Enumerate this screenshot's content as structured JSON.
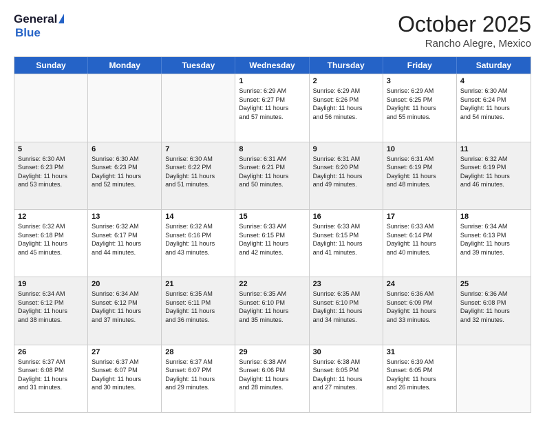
{
  "header": {
    "logo_general": "General",
    "logo_blue": "Blue",
    "month": "October 2025",
    "location": "Rancho Alegre, Mexico"
  },
  "days_of_week": [
    "Sunday",
    "Monday",
    "Tuesday",
    "Wednesday",
    "Thursday",
    "Friday",
    "Saturday"
  ],
  "weeks": [
    [
      {
        "day": "",
        "info": ""
      },
      {
        "day": "",
        "info": ""
      },
      {
        "day": "",
        "info": ""
      },
      {
        "day": "1",
        "info": "Sunrise: 6:29 AM\nSunset: 6:27 PM\nDaylight: 11 hours\nand 57 minutes."
      },
      {
        "day": "2",
        "info": "Sunrise: 6:29 AM\nSunset: 6:26 PM\nDaylight: 11 hours\nand 56 minutes."
      },
      {
        "day": "3",
        "info": "Sunrise: 6:29 AM\nSunset: 6:25 PM\nDaylight: 11 hours\nand 55 minutes."
      },
      {
        "day": "4",
        "info": "Sunrise: 6:30 AM\nSunset: 6:24 PM\nDaylight: 11 hours\nand 54 minutes."
      }
    ],
    [
      {
        "day": "5",
        "info": "Sunrise: 6:30 AM\nSunset: 6:23 PM\nDaylight: 11 hours\nand 53 minutes."
      },
      {
        "day": "6",
        "info": "Sunrise: 6:30 AM\nSunset: 6:23 PM\nDaylight: 11 hours\nand 52 minutes."
      },
      {
        "day": "7",
        "info": "Sunrise: 6:30 AM\nSunset: 6:22 PM\nDaylight: 11 hours\nand 51 minutes."
      },
      {
        "day": "8",
        "info": "Sunrise: 6:31 AM\nSunset: 6:21 PM\nDaylight: 11 hours\nand 50 minutes."
      },
      {
        "day": "9",
        "info": "Sunrise: 6:31 AM\nSunset: 6:20 PM\nDaylight: 11 hours\nand 49 minutes."
      },
      {
        "day": "10",
        "info": "Sunrise: 6:31 AM\nSunset: 6:19 PM\nDaylight: 11 hours\nand 48 minutes."
      },
      {
        "day": "11",
        "info": "Sunrise: 6:32 AM\nSunset: 6:19 PM\nDaylight: 11 hours\nand 46 minutes."
      }
    ],
    [
      {
        "day": "12",
        "info": "Sunrise: 6:32 AM\nSunset: 6:18 PM\nDaylight: 11 hours\nand 45 minutes."
      },
      {
        "day": "13",
        "info": "Sunrise: 6:32 AM\nSunset: 6:17 PM\nDaylight: 11 hours\nand 44 minutes."
      },
      {
        "day": "14",
        "info": "Sunrise: 6:32 AM\nSunset: 6:16 PM\nDaylight: 11 hours\nand 43 minutes."
      },
      {
        "day": "15",
        "info": "Sunrise: 6:33 AM\nSunset: 6:15 PM\nDaylight: 11 hours\nand 42 minutes."
      },
      {
        "day": "16",
        "info": "Sunrise: 6:33 AM\nSunset: 6:15 PM\nDaylight: 11 hours\nand 41 minutes."
      },
      {
        "day": "17",
        "info": "Sunrise: 6:33 AM\nSunset: 6:14 PM\nDaylight: 11 hours\nand 40 minutes."
      },
      {
        "day": "18",
        "info": "Sunrise: 6:34 AM\nSunset: 6:13 PM\nDaylight: 11 hours\nand 39 minutes."
      }
    ],
    [
      {
        "day": "19",
        "info": "Sunrise: 6:34 AM\nSunset: 6:12 PM\nDaylight: 11 hours\nand 38 minutes."
      },
      {
        "day": "20",
        "info": "Sunrise: 6:34 AM\nSunset: 6:12 PM\nDaylight: 11 hours\nand 37 minutes."
      },
      {
        "day": "21",
        "info": "Sunrise: 6:35 AM\nSunset: 6:11 PM\nDaylight: 11 hours\nand 36 minutes."
      },
      {
        "day": "22",
        "info": "Sunrise: 6:35 AM\nSunset: 6:10 PM\nDaylight: 11 hours\nand 35 minutes."
      },
      {
        "day": "23",
        "info": "Sunrise: 6:35 AM\nSunset: 6:10 PM\nDaylight: 11 hours\nand 34 minutes."
      },
      {
        "day": "24",
        "info": "Sunrise: 6:36 AM\nSunset: 6:09 PM\nDaylight: 11 hours\nand 33 minutes."
      },
      {
        "day": "25",
        "info": "Sunrise: 6:36 AM\nSunset: 6:08 PM\nDaylight: 11 hours\nand 32 minutes."
      }
    ],
    [
      {
        "day": "26",
        "info": "Sunrise: 6:37 AM\nSunset: 6:08 PM\nDaylight: 11 hours\nand 31 minutes."
      },
      {
        "day": "27",
        "info": "Sunrise: 6:37 AM\nSunset: 6:07 PM\nDaylight: 11 hours\nand 30 minutes."
      },
      {
        "day": "28",
        "info": "Sunrise: 6:37 AM\nSunset: 6:07 PM\nDaylight: 11 hours\nand 29 minutes."
      },
      {
        "day": "29",
        "info": "Sunrise: 6:38 AM\nSunset: 6:06 PM\nDaylight: 11 hours\nand 28 minutes."
      },
      {
        "day": "30",
        "info": "Sunrise: 6:38 AM\nSunset: 6:05 PM\nDaylight: 11 hours\nand 27 minutes."
      },
      {
        "day": "31",
        "info": "Sunrise: 6:39 AM\nSunset: 6:05 PM\nDaylight: 11 hours\nand 26 minutes."
      },
      {
        "day": "",
        "info": ""
      }
    ]
  ]
}
